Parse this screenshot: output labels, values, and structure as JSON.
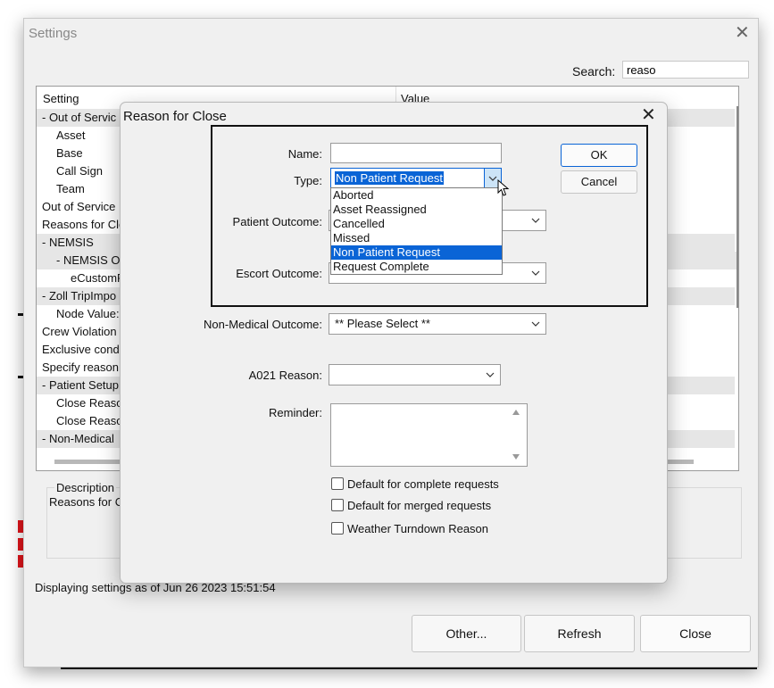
{
  "settings": {
    "title": "Settings",
    "search_label": "Search:",
    "search_value": "reaso",
    "columns": {
      "setting": "Setting",
      "value": "Value"
    },
    "rows": [
      "-  Out of Servic",
      "Asset",
      "Base",
      "Call Sign",
      "Team",
      "Out of Service I",
      "Reasons for Clo",
      "-  NEMSIS",
      "-  NEMSIS O",
      "eCustomR",
      "-  Zoll TripImpo",
      "Node Value:",
      "Crew Violation",
      "Exclusive condit",
      "Specify reason",
      "-  Patient Setup",
      "Close Reaso",
      "Close Reaso",
      "-  Non-Medical"
    ],
    "description_label": "Description",
    "description_text": "Reasons for C",
    "status": "Displaying settings as of Jun 26 2023 15:51:54",
    "buttons": {
      "other": "Other...",
      "refresh": "Refresh",
      "close": "Close"
    }
  },
  "dialog": {
    "title": "Reason for Close",
    "name_label": "Name:",
    "name_value": "",
    "type_label": "Type:",
    "type_value": "Non Patient Request",
    "type_options": [
      "Aborted",
      "Asset Reassigned",
      "Cancelled",
      "Missed",
      "Non Patient Request",
      "Request Complete"
    ],
    "patient_outcome_label": "Patient Outcome:",
    "escort_outcome_label": "Escort Outcome:",
    "non_medical_outcome_label": "Non-Medical Outcome:",
    "non_medical_outcome_value": "** Please Select **",
    "a021_reason_label": "A021 Reason:",
    "a021_reason_value": "",
    "reminder_label": "Reminder:",
    "reminder_value": "",
    "checkboxes": {
      "default_complete": "Default for complete requests",
      "default_merged": "Default for merged requests",
      "weather_turndown": "Weather Turndown Reason"
    },
    "ok_label": "OK",
    "cancel_label": "Cancel"
  },
  "colors": {
    "selection": "#0a64d6",
    "window_bg": "#f0f0f0",
    "accent_red": "#e0151b"
  },
  "icons": [
    "close-icon",
    "chevron-down-icon",
    "scroll-up-icon",
    "scroll-down-icon",
    "mouse-cursor-icon"
  ]
}
